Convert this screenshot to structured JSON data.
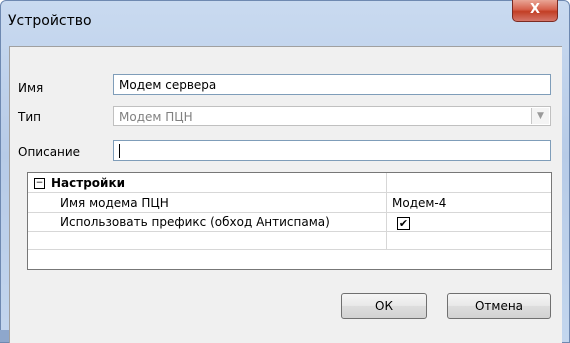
{
  "window": {
    "title": "Устройство",
    "close_label": "X"
  },
  "form": {
    "name_label": "Имя",
    "name_value": "Модем сервера",
    "type_label": "Тип",
    "type_value": "Модем ПЦН",
    "description_label": "Описание",
    "description_value": ""
  },
  "settings": {
    "expander_symbol": "−",
    "section_title": "Настройки",
    "rows": [
      {
        "label": "Имя модема ПЦН",
        "value": "Модем-4"
      },
      {
        "label": "Использовать префикс (обход Антиспама)",
        "checked": true,
        "check_symbol": "✔"
      }
    ]
  },
  "buttons": {
    "ok": "ОК",
    "cancel": "Отмена"
  }
}
